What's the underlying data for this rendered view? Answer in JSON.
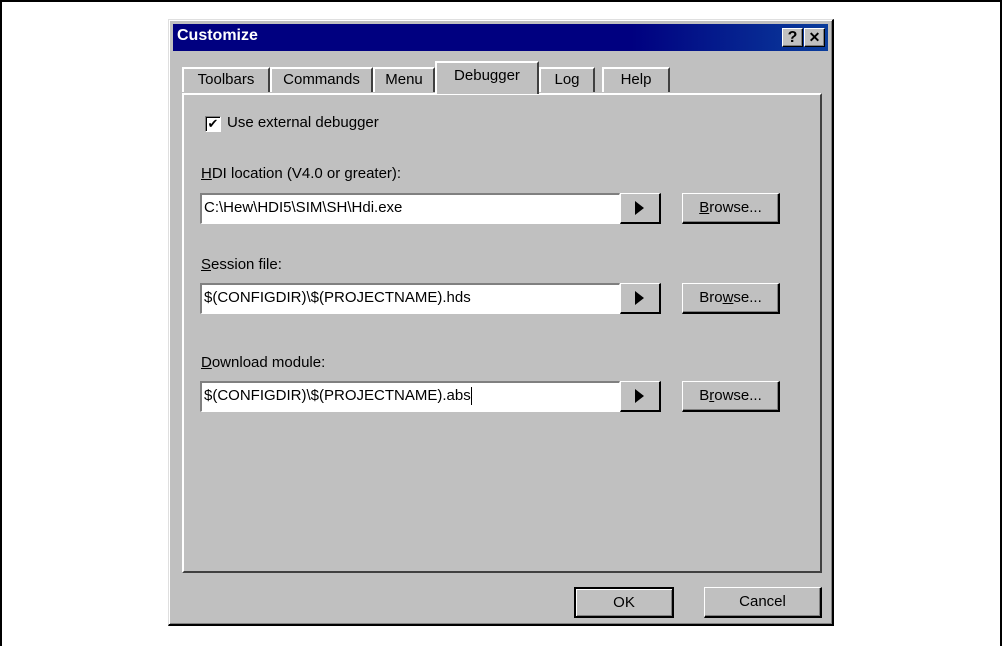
{
  "window": {
    "title": "Customize",
    "help_button": "?",
    "close_button": "✕"
  },
  "tabs": [
    {
      "label": "Toolbars",
      "active": false
    },
    {
      "label": "Commands",
      "active": false
    },
    {
      "label": "Menu",
      "active": false
    },
    {
      "label": "Debugger",
      "active": true
    },
    {
      "label": "Log",
      "active": false
    },
    {
      "label": "Help",
      "active": false
    }
  ],
  "debugger": {
    "use_external": {
      "label": "Use external debugger",
      "checked": true
    },
    "hdi_location": {
      "label_accel": "H",
      "label_rest": "DI location (V4.0 or greater):",
      "value": "C:\\Hew\\HDI5\\SIM\\SH\\Hdi.exe",
      "browse": {
        "pre": "",
        "accel": "B",
        "post": "rowse..."
      }
    },
    "session_file": {
      "label_accel": "S",
      "label_rest": "ession file:",
      "value": "$(CONFIGDIR)\\$(PROJECTNAME).hds",
      "browse": {
        "pre": "Bro",
        "accel": "w",
        "post": "se..."
      }
    },
    "download_module": {
      "label_accel": "D",
      "label_rest": "ownload module:",
      "value": "$(CONFIGDIR)\\$(PROJECTNAME).abs",
      "browse": {
        "pre": "B",
        "accel": "r",
        "post": "owse..."
      }
    }
  },
  "footer": {
    "ok_label": "OK",
    "cancel_label": "Cancel"
  },
  "icons": {
    "checkbox_check": "check-icon",
    "insert_macro_arrow": "right-triangle-icon"
  }
}
